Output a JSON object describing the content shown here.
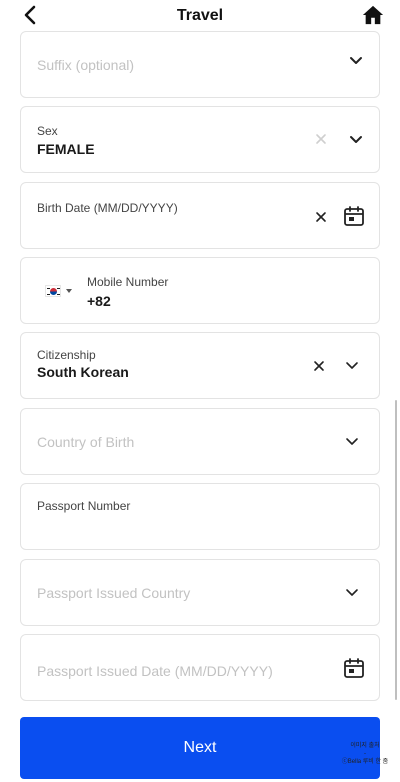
{
  "header": {
    "title": "Travel"
  },
  "fields": {
    "suffix": {
      "placeholder": "Suffix (optional)"
    },
    "sex": {
      "label": "Sex",
      "value": "FEMALE"
    },
    "birth_date": {
      "label": "Birth Date (MM/DD/YYYY)",
      "value": ""
    },
    "mobile": {
      "label": "Mobile Number",
      "code": "+82"
    },
    "citizenship": {
      "label": "Citizenship",
      "value": "South Korean"
    },
    "country_of_birth": {
      "placeholder": "Country of Birth"
    },
    "passport_number": {
      "label": "Passport Number",
      "value": ""
    },
    "passport_issued_country": {
      "placeholder": "Passport Issued Country"
    },
    "passport_issued_date": {
      "placeholder": "Passport Issued Date (MM/DD/YYYY)"
    }
  },
  "actions": {
    "next_label": "Next"
  },
  "watermark": {
    "line1": "이미지 출처",
    "line2": "-",
    "line3": "ⓒBella 루비 한 줌"
  },
  "colors": {
    "primary": "#0a4ef0",
    "border": "#e3e3e3",
    "placeholder": "#c2c2c2"
  },
  "icons": {
    "back": "chevron-left-icon",
    "home": "home-icon",
    "dropdown": "chevron-down-icon",
    "clear": "close-icon",
    "calendar": "calendar-icon",
    "flag": "south-korea-flag-icon"
  }
}
